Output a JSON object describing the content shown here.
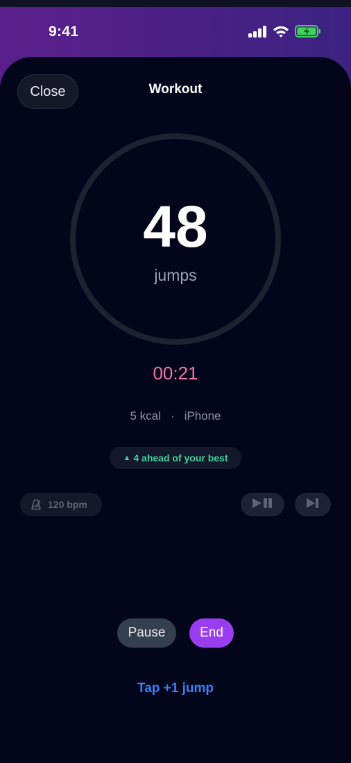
{
  "status_bar": {
    "time": "9:41",
    "icons": [
      "cellular-signal-icon",
      "wifi-icon",
      "battery-charging-icon"
    ],
    "battery_color": "#3fd25a"
  },
  "header": {
    "close_label": "Close",
    "title": "Workout"
  },
  "counter": {
    "count": "48",
    "unit": "jumps",
    "ring_color": "#1e2230"
  },
  "timer": "00:21",
  "meta": {
    "calories": "5 kcal",
    "separator": "·",
    "device": "iPhone"
  },
  "best_badge": {
    "arrow": "▲",
    "text": "4 ahead of your best",
    "color": "#3fd2a2"
  },
  "music": {
    "metronome_icon": "metronome-icon",
    "bpm": "120 bpm",
    "play_pause_icon": "play-pause-icon",
    "skip_icon": "skip-forward-icon"
  },
  "controls": {
    "pause_label": "Pause",
    "end_label": "End",
    "end_color": "#9a3df0"
  },
  "tap_label": "Tap +1 jump",
  "colors": {
    "accent_pink": "#f075a8",
    "link_blue": "#3d7ff2",
    "header_purple": "#5a1f8c"
  }
}
